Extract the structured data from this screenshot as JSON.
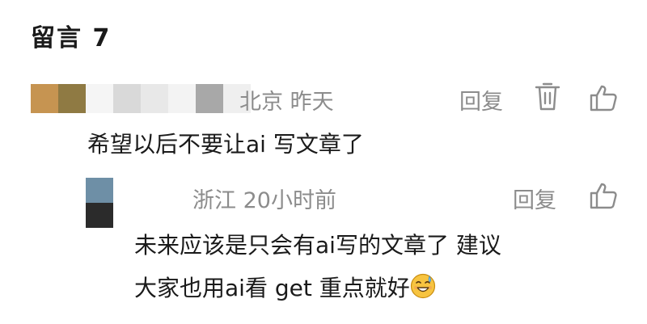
{
  "header": {
    "title": "留言 7"
  },
  "comments": [
    {
      "location_time": "北京 昨天",
      "reply_label": "回复",
      "text": "希望以后不要让ai 写文章了",
      "avatar_colors": [
        "#c69451",
        "#8f7a43",
        "#f5f5f5",
        "#d6d6d6",
        "#e6e6e6",
        "#f2f2f2",
        "#a3a3a3",
        "#eeeeee"
      ]
    }
  ],
  "replies": [
    {
      "location_time": "浙江 20小时前",
      "reply_label": "回复",
      "text_line1": "未来应该是只会有ai写的文章了 建议",
      "text_line2": "大家也用ai看 get 重点就好",
      "emoji": "sweat-smile-emoji",
      "avatar_colors": [
        "#6e8fa6",
        "#2b2b2b"
      ]
    }
  ],
  "icons": {
    "delete": "trash-icon",
    "like": "thumbs-up-icon"
  },
  "colors": {
    "meta_gray": "#8c8c8c",
    "text_dark": "#1a1a1a"
  }
}
